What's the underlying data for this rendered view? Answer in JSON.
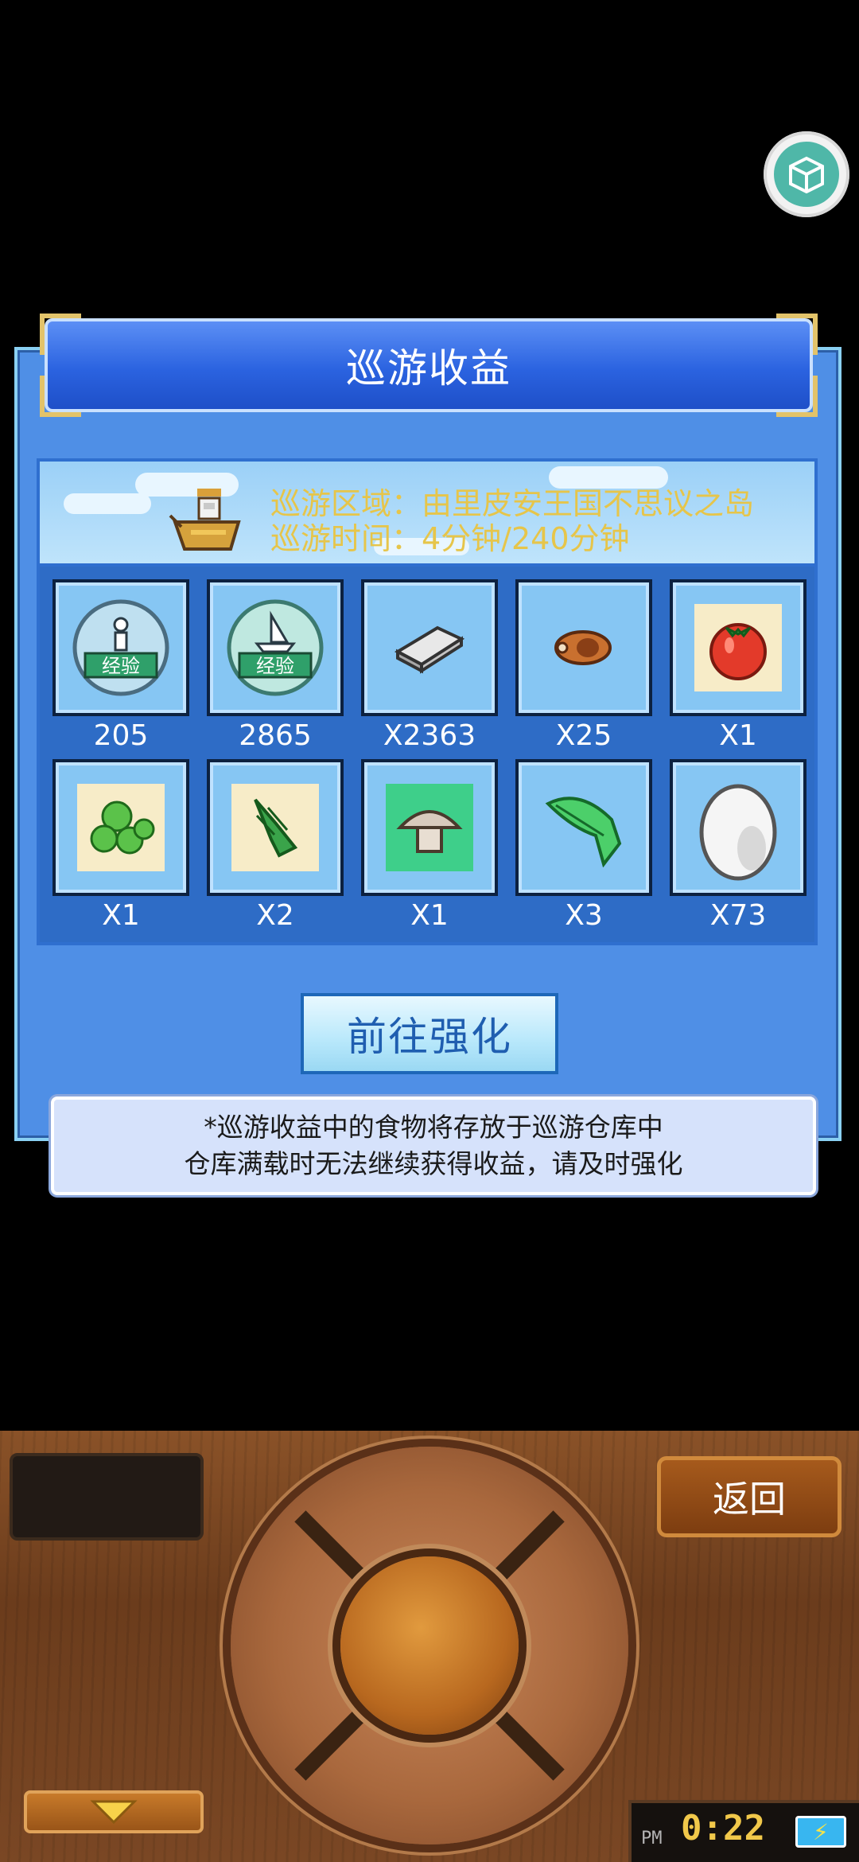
{
  "dialog": {
    "title": "巡游收益",
    "area_line": "巡游区域：由里皮安王国不思议之岛",
    "time_line": "巡游时间：4分钟/240分钟"
  },
  "items": [
    {
      "icon": "exp-person-icon",
      "qty": "205"
    },
    {
      "icon": "exp-ship-icon",
      "qty": "2865"
    },
    {
      "icon": "silver-ingot-icon",
      "qty": "X2363"
    },
    {
      "icon": "meat-icon",
      "qty": "X25"
    },
    {
      "icon": "tomato-icon",
      "qty": "X1"
    },
    {
      "icon": "green-peas-icon",
      "qty": "X1"
    },
    {
      "icon": "green-herb-icon",
      "qty": "X2"
    },
    {
      "icon": "mushroom-icon",
      "qty": "X1"
    },
    {
      "icon": "green-leaf-icon",
      "qty": "X3"
    },
    {
      "icon": "egg-icon",
      "qty": "X73"
    }
  ],
  "exp_badge_label": "经验",
  "enhance_button": "前往强化",
  "notice": {
    "line1": "*巡游收益中的食物将存放于巡游仓库中",
    "line2": "仓库满载时无法继续获得收益，请及时强化"
  },
  "console": {
    "back_label": "返回",
    "clock_ampm": "PM",
    "clock_time": "0:22"
  }
}
